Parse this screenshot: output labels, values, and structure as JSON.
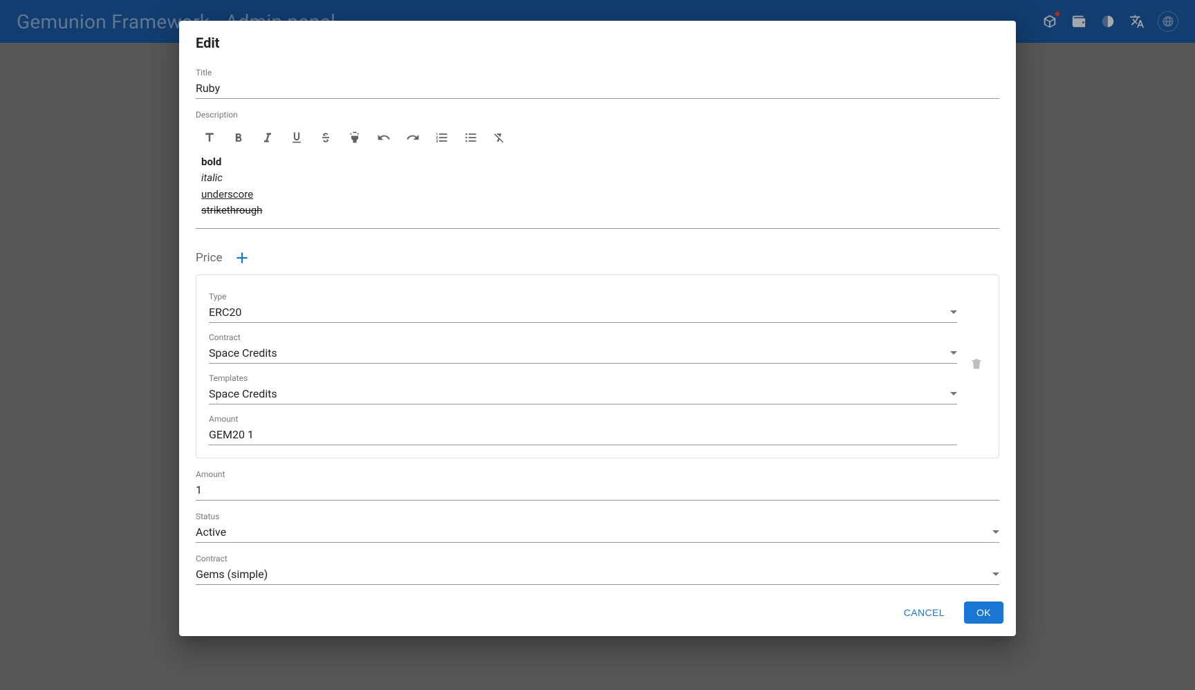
{
  "appbar": {
    "title": "Gemunion Framework - Admin panel"
  },
  "dialog": {
    "title": "Edit",
    "fields": {
      "title": {
        "label": "Title",
        "value": "Ruby"
      },
      "description": {
        "label": "Description",
        "content": {
          "bold": "bold",
          "italic": "italic",
          "underscore": "underscore",
          "strike": "strikethrough"
        }
      },
      "price": {
        "label": "Price",
        "card": {
          "type": {
            "label": "Type",
            "value": "ERC20"
          },
          "contract": {
            "label": "Contract",
            "value": "Space Credits"
          },
          "templates": {
            "label": "Templates",
            "value": "Space Credits"
          },
          "amount": {
            "label": "Amount",
            "value": "GEM20 1"
          }
        }
      },
      "amount": {
        "label": "Amount",
        "value": "1"
      },
      "status": {
        "label": "Status",
        "value": "Active"
      },
      "contract": {
        "label": "Contract",
        "value": "Gems (simple)"
      }
    },
    "actions": {
      "cancel": "Cancel",
      "ok": "OK"
    }
  }
}
